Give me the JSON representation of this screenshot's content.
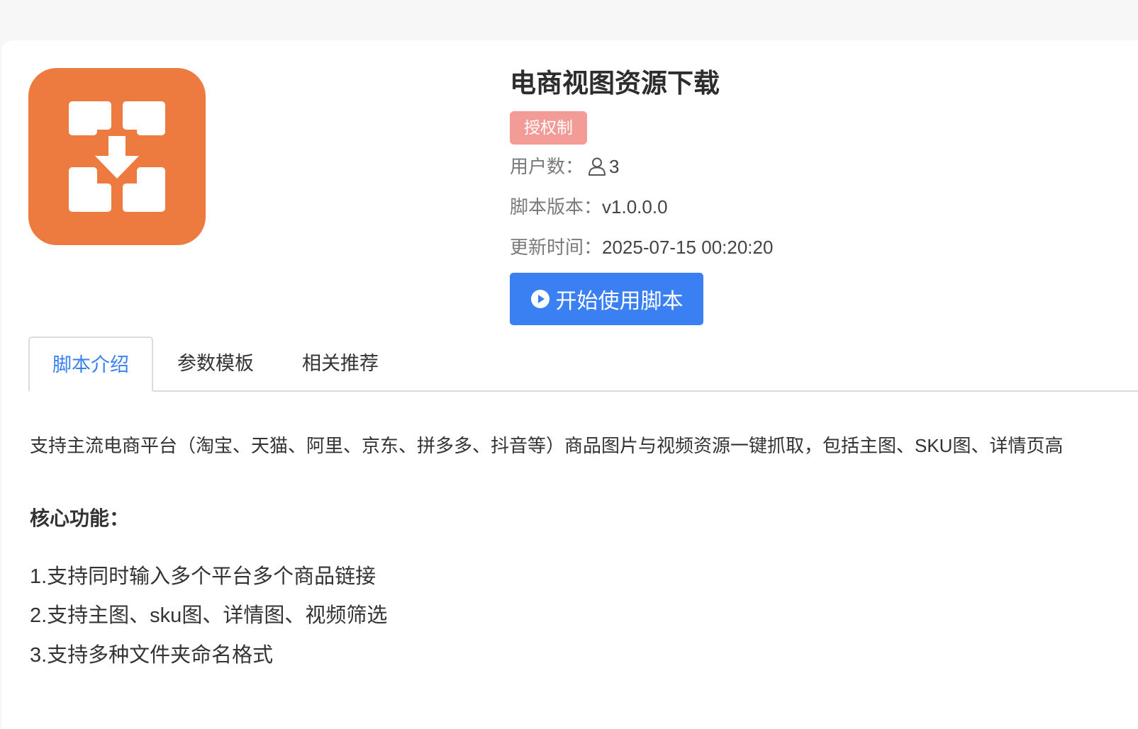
{
  "app": {
    "title": "电商视图资源下载",
    "badge": "授权制",
    "icon": "download-arrows-icon",
    "icon_color": "#ED7A3F"
  },
  "meta": {
    "users_label": "用户数：",
    "users_count": "3",
    "version_label": "脚本版本：",
    "version_value": "v1.0.0.0",
    "updated_label": "更新时间：",
    "updated_value": "2025-07-15 00:20:20"
  },
  "actions": {
    "start_label": "开始使用脚本"
  },
  "tabs": [
    {
      "label": "脚本介绍",
      "active": true
    },
    {
      "label": "参数模板",
      "active": false
    },
    {
      "label": "相关推荐",
      "active": false
    }
  ],
  "intro": {
    "description": "支持主流电商平台（淘宝、天猫、阿里、京东、拼多多、抖音等）商品图片与视频资源一键抓取，包括主图、SKU图、详情页高",
    "features_title": "核心功能：",
    "features": [
      "1.支持同时输入多个平台多个商品链接",
      "2.支持主图、sku图、详情图、视频筛选",
      "3.支持多种文件夹命名格式"
    ]
  },
  "colors": {
    "accent": "#3A80F3",
    "badge_bg": "#F29B97",
    "brand_orange": "#ED7A3F"
  }
}
